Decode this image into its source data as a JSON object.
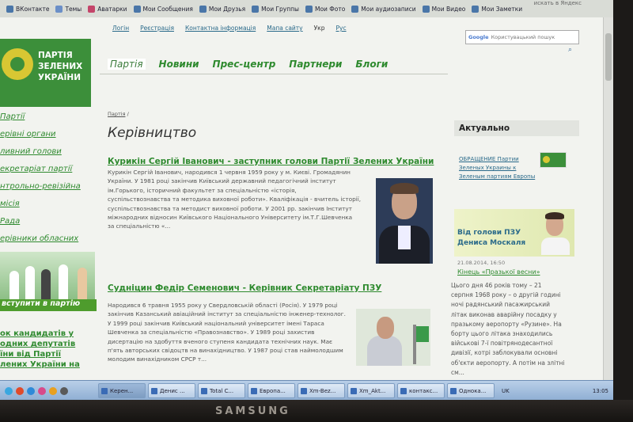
{
  "bookmarks": [
    {
      "label": "ВКонтакте",
      "color": "#4a76a8"
    },
    {
      "label": "Темы",
      "color": "#6b8fc7"
    },
    {
      "label": "Аватарки",
      "color": "#c4456a"
    },
    {
      "label": "Мои Сообщения",
      "color": "#4a76a8"
    },
    {
      "label": "Мои Друзья",
      "color": "#4a76a8"
    },
    {
      "label": "Мои Группы",
      "color": "#4a76a8"
    },
    {
      "label": "Мои Фото",
      "color": "#4a76a8"
    },
    {
      "label": "Мои аудиозаписи",
      "color": "#4a76a8"
    },
    {
      "label": "Мои Видео",
      "color": "#4a76a8"
    },
    {
      "label": "Мои Заметки",
      "color": "#4a76a8"
    }
  ],
  "yandex_hint": "искать в Яндекс",
  "logo": {
    "line1": "ПАРТІЯ",
    "line2": "ЗЕЛЕНИХ",
    "line3": "УКРАЇНИ"
  },
  "toplinks": [
    "Логін",
    "Реєстрація",
    "Контактна інформація",
    "Мапа сайту"
  ],
  "lang": {
    "ukr": "Укр",
    "rus": "Рус"
  },
  "search": {
    "brand": "Google",
    "placeholder": "Користувацький пошук"
  },
  "nav": [
    "Партія",
    "Новини",
    "Прес-центр",
    "Партнери",
    "Блоги"
  ],
  "leftmenu": [
    "Партії",
    "ерівні органи",
    "ливний голови",
    "екретаріат партії",
    "нтрольно-ревізійна",
    "місія",
    "Рада",
    "ерівники обласних",
    "нізацій"
  ],
  "join_label": "вступити в партію",
  "leftbottom": [
    "ок кандидатів у",
    "одних депутатів",
    "їни від Партії",
    "лених України на"
  ],
  "breadcrumb": "Партія",
  "page_title": "Керівництво",
  "person1": {
    "name": "Курикін Сергій Іванович - заступник голови Партії Зелених України",
    "bio": [
      "Курикін Сергій Іванович, народився 1 червня 1959 року у м. Києві. Громадянин",
      "України. У 1981 році закінчив Київський державний педагогічний інститут",
      "ім.Горького, історичний факультет за спеціальністю «історія,",
      "суспільствознавства та методика виховної роботи». Кваліфікація - вчитель історії,",
      "суспільствознавства та методист виховної роботи. У 2001 рр. закінчив Інститут",
      "міжнародних відносин Київського Національного Університету ім.Т.Г.Шевченка",
      "за спеціальністю «..."
    ]
  },
  "person2": {
    "name": "Судніцин Федір Семенович - Керівник Секретаріату ПЗУ",
    "bio": [
      "Народився 6 травня 1955 року у Свердловській області (Росія). У 1979 році",
      "закінчив Казанський авіаційний інститут за спеціальністю інженер-технолог.",
      "У 1999 році закінчив Київський національний університет імені Тараса",
      "Шевченка за спеціальністю «Правознавство». У 1989 році захистив",
      "дисертацію на здобуття вченого ступеня кандидата технічних наук. Має",
      "п'ять авторських свідоцтв на винахідництво. У 1987 році став наймолодшим",
      "молодим винахідником СРСР т..."
    ]
  },
  "aktual": "Актуально",
  "obrashchenie": [
    "ОБРАЩЕНИЕ Партии",
    "Зеленых Украины к",
    "Зеленым партиям Европы"
  ],
  "vid": {
    "line1": "Від голови ПЗУ",
    "line2": "Дениса Москаля"
  },
  "news_date": "21.08.2014, 16:50",
  "news_title": "Кінець «Празької весни»",
  "news_text": [
    "Цього дня 46 років тому – 21",
    "серпня 1968 року – о другій годині",
    "ночі радянський пасажирський",
    "літак виконав аварійну посадку у",
    "празькому аеропорту «Рузине». На",
    "борту цього літака знаходились",
    "військові 7-ї повітрянодесантної",
    "дивізії, котрі заблокували основні",
    "об'єкти аеропорту. А потім на злітні",
    "см..."
  ],
  "taskbar": {
    "tasks": [
      "Керен...",
      "Денис ...",
      "Total C...",
      "Европа...",
      "Xm-Bez...",
      "Xm_Akt...",
      "контакс...",
      "Однока..."
    ],
    "lang": "UK",
    "clock": "13:05"
  },
  "brand": "SAMSUNG"
}
